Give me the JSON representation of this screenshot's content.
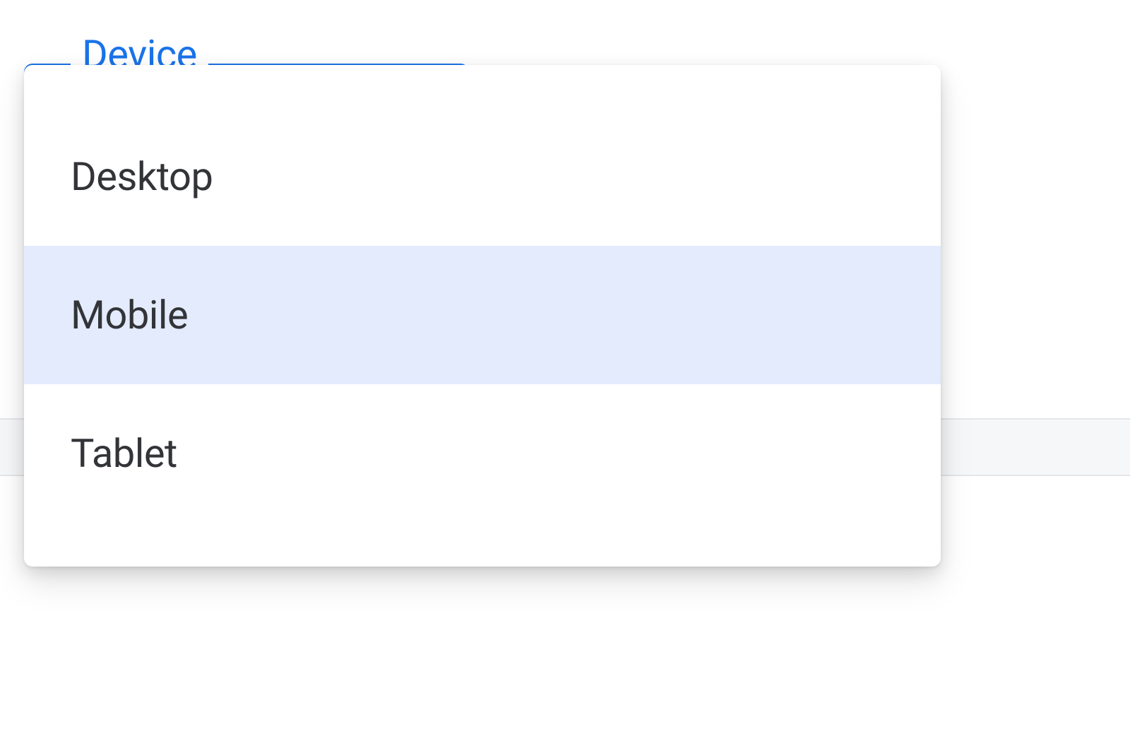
{
  "select": {
    "label": "Device",
    "selected_index": 1,
    "options": [
      {
        "label": "Desktop"
      },
      {
        "label": "Mobile"
      },
      {
        "label": "Tablet"
      }
    ]
  }
}
